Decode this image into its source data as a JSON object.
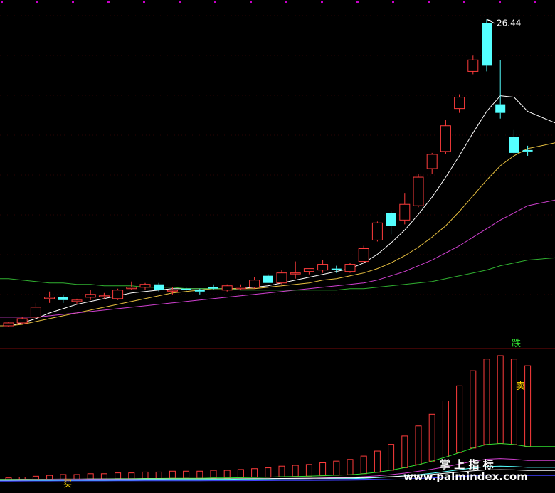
{
  "chart_data": {
    "type": "candlestick",
    "high_label": "26.44",
    "top_markers_color": "#c800c8",
    "colors": {
      "up": "#ff3c3c",
      "down": "#54ffff",
      "ma_white": "#ffffff",
      "ma_yellow": "#e8c040",
      "ma_magenta": "#d040d0",
      "ma_green": "#30b030",
      "divider": "#7a0a0a",
      "grid": "#5a0a0a"
    },
    "price_range": [
      4.8,
      27.3
    ],
    "candles": [
      {
        "o": 5.0,
        "h": 5.3,
        "l": 4.9,
        "c": 5.2
      },
      {
        "o": 5.2,
        "h": 5.6,
        "l": 5.1,
        "c": 5.5
      },
      {
        "o": 5.6,
        "h": 6.6,
        "l": 5.5,
        "c": 6.3
      },
      {
        "o": 6.9,
        "h": 7.4,
        "l": 6.6,
        "c": 7.0
      },
      {
        "o": 7.0,
        "h": 7.2,
        "l": 6.6,
        "c": 6.8
      },
      {
        "o": 6.7,
        "h": 6.9,
        "l": 6.5,
        "c": 6.8
      },
      {
        "o": 7.0,
        "h": 7.5,
        "l": 6.8,
        "c": 7.2
      },
      {
        "o": 7.1,
        "h": 7.3,
        "l": 6.9,
        "c": 7.1
      },
      {
        "o": 6.9,
        "h": 7.6,
        "l": 6.8,
        "c": 7.5
      },
      {
        "o": 7.6,
        "h": 8.1,
        "l": 7.5,
        "c": 7.7
      },
      {
        "o": 7.7,
        "h": 8.0,
        "l": 7.5,
        "c": 7.9
      },
      {
        "o": 7.9,
        "h": 8.0,
        "l": 7.4,
        "c": 7.5
      },
      {
        "o": 7.5,
        "h": 7.7,
        "l": 7.2,
        "c": 7.5
      },
      {
        "o": 7.6,
        "h": 7.7,
        "l": 7.4,
        "c": 7.5
      },
      {
        "o": 7.5,
        "h": 7.6,
        "l": 7.2,
        "c": 7.4
      },
      {
        "o": 7.7,
        "h": 7.9,
        "l": 7.5,
        "c": 7.6
      },
      {
        "o": 7.5,
        "h": 7.9,
        "l": 7.4,
        "c": 7.8
      },
      {
        "o": 7.6,
        "h": 7.9,
        "l": 7.5,
        "c": 7.7
      },
      {
        "o": 7.7,
        "h": 8.4,
        "l": 7.6,
        "c": 8.2
      },
      {
        "o": 8.5,
        "h": 8.6,
        "l": 8.0,
        "c": 8.0
      },
      {
        "o": 8.0,
        "h": 8.9,
        "l": 7.9,
        "c": 8.7
      },
      {
        "o": 8.7,
        "h": 9.5,
        "l": 8.3,
        "c": 8.7
      },
      {
        "o": 8.8,
        "h": 9.0,
        "l": 8.6,
        "c": 9.0
      },
      {
        "o": 8.9,
        "h": 9.6,
        "l": 8.7,
        "c": 9.3
      },
      {
        "o": 9.0,
        "h": 9.2,
        "l": 8.7,
        "c": 8.9
      },
      {
        "o": 8.8,
        "h": 9.4,
        "l": 8.7,
        "c": 9.3
      },
      {
        "o": 9.5,
        "h": 10.6,
        "l": 9.4,
        "c": 10.4
      },
      {
        "o": 11.0,
        "h": 12.3,
        "l": 10.9,
        "c": 12.2
      },
      {
        "o": 12.9,
        "h": 13.0,
        "l": 11.4,
        "c": 12.0
      },
      {
        "o": 12.4,
        "h": 14.3,
        "l": 12.1,
        "c": 13.5
      },
      {
        "o": 13.4,
        "h": 15.6,
        "l": 13.3,
        "c": 15.4
      },
      {
        "o": 16.0,
        "h": 17.1,
        "l": 15.6,
        "c": 17.0
      },
      {
        "o": 17.2,
        "h": 19.4,
        "l": 17.0,
        "c": 19.0
      },
      {
        "o": 20.2,
        "h": 21.2,
        "l": 19.9,
        "c": 21.0
      },
      {
        "o": 22.8,
        "h": 23.9,
        "l": 22.6,
        "c": 23.6
      },
      {
        "o": 26.2,
        "h": 26.44,
        "l": 22.8,
        "c": 23.2
      },
      {
        "o": 20.5,
        "h": 23.6,
        "l": 19.5,
        "c": 19.9
      },
      {
        "o": 18.2,
        "h": 18.7,
        "l": 17.0,
        "c": 17.1
      },
      {
        "o": 17.3,
        "h": 17.6,
        "l": 16.9,
        "c": 17.2
      }
    ],
    "ma": [
      {
        "color": "#ffffff",
        "values": [
          5.0,
          5.2,
          5.5,
          5.9,
          6.2,
          6.5,
          6.7,
          6.9,
          7.1,
          7.3,
          7.4,
          7.5,
          7.6,
          7.6,
          7.6,
          7.6,
          7.6,
          7.6,
          7.7,
          7.8,
          8.0,
          8.2,
          8.4,
          8.6,
          8.8,
          9.0,
          9.4,
          10.0,
          10.8,
          11.7,
          12.8,
          14.0,
          15.4,
          16.9,
          18.5,
          20.0,
          21.1,
          21.0,
          20.0
        ]
      },
      {
        "color": "#e8c040",
        "values": [
          5.0,
          5.1,
          5.3,
          5.5,
          5.7,
          5.9,
          6.1,
          6.3,
          6.5,
          6.7,
          6.9,
          7.1,
          7.3,
          7.4,
          7.5,
          7.6,
          7.6,
          7.6,
          7.6,
          7.7,
          7.8,
          7.9,
          8.0,
          8.2,
          8.3,
          8.5,
          8.7,
          9.0,
          9.4,
          9.9,
          10.5,
          11.2,
          12.0,
          13.0,
          14.1,
          15.2,
          16.2,
          16.9,
          17.4
        ]
      },
      {
        "color": "#d040d0",
        "values": [
          5.6,
          5.6,
          5.6,
          5.7,
          5.8,
          5.9,
          6.0,
          6.1,
          6.2,
          6.3,
          6.4,
          6.5,
          6.6,
          6.7,
          6.8,
          6.9,
          7.0,
          7.1,
          7.2,
          7.3,
          7.4,
          7.5,
          7.6,
          7.7,
          7.8,
          7.9,
          8.0,
          8.2,
          8.5,
          8.8,
          9.2,
          9.6,
          10.1,
          10.6,
          11.2,
          11.8,
          12.4,
          12.9,
          13.4
        ]
      },
      {
        "color": "#30b030",
        "values": [
          8.3,
          8.2,
          8.1,
          8.0,
          8.0,
          7.9,
          7.9,
          7.8,
          7.8,
          7.8,
          7.7,
          7.7,
          7.7,
          7.6,
          7.6,
          7.6,
          7.6,
          7.5,
          7.5,
          7.5,
          7.5,
          7.5,
          7.5,
          7.5,
          7.5,
          7.6,
          7.6,
          7.7,
          7.8,
          7.9,
          8.0,
          8.1,
          8.3,
          8.5,
          8.7,
          8.9,
          9.2,
          9.4,
          9.6
        ]
      }
    ],
    "indicator": {
      "bars": [
        0.4,
        0.5,
        0.6,
        0.7,
        0.8,
        0.8,
        0.9,
        0.9,
        1.0,
        1.0,
        1.1,
        1.1,
        1.2,
        1.2,
        1.2,
        1.3,
        1.3,
        1.4,
        1.5,
        1.6,
        1.8,
        1.9,
        2.0,
        2.2,
        2.4,
        2.6,
        3.0,
        3.6,
        4.4,
        5.4,
        6.6,
        8.0,
        9.6,
        11.4,
        13.2,
        14.6,
        15.0,
        14.6,
        13.8
      ],
      "range": [
        -3,
        80
      ],
      "signal_die": "跌",
      "signal_sell": "卖",
      "signal_buy": "买"
    },
    "watermark_cn": "掌 上 指 标",
    "watermark_url": "www.palmindex.com"
  }
}
